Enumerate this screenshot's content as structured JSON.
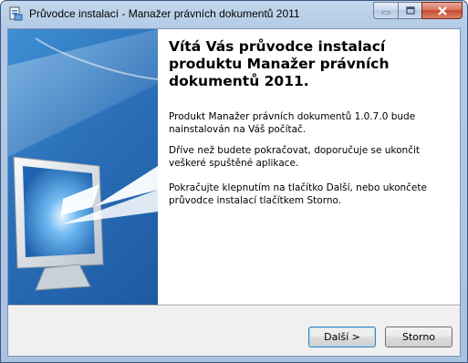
{
  "window": {
    "title": "Průvodce instalací - Manažer právních dokumentů 2011",
    "icon": "installer-icon",
    "caption_buttons": [
      "minimize-icon",
      "maximize-icon",
      "close-icon"
    ]
  },
  "main": {
    "heading": "Vítá Vás průvodce instalací produktu Manažer právních dokumentů 2011.",
    "paragraphs": [
      "Produkt Manažer právních dokumentů 1.0.7.0 bude nainstalován na Váš počítač.",
      "Dříve než budete pokračovat, doporučuje se ukončit veškeré spuštěné aplikace.",
      "Pokračujte klepnutím na tlačítko Další, nebo ukončete průvodce instalací tlačítkem Storno."
    ]
  },
  "buttons": {
    "next_label": "Další >",
    "cancel_label": "Storno"
  },
  "colors": {
    "side_panel": "#2a6fb8",
    "accent": "#3c7fb1"
  }
}
